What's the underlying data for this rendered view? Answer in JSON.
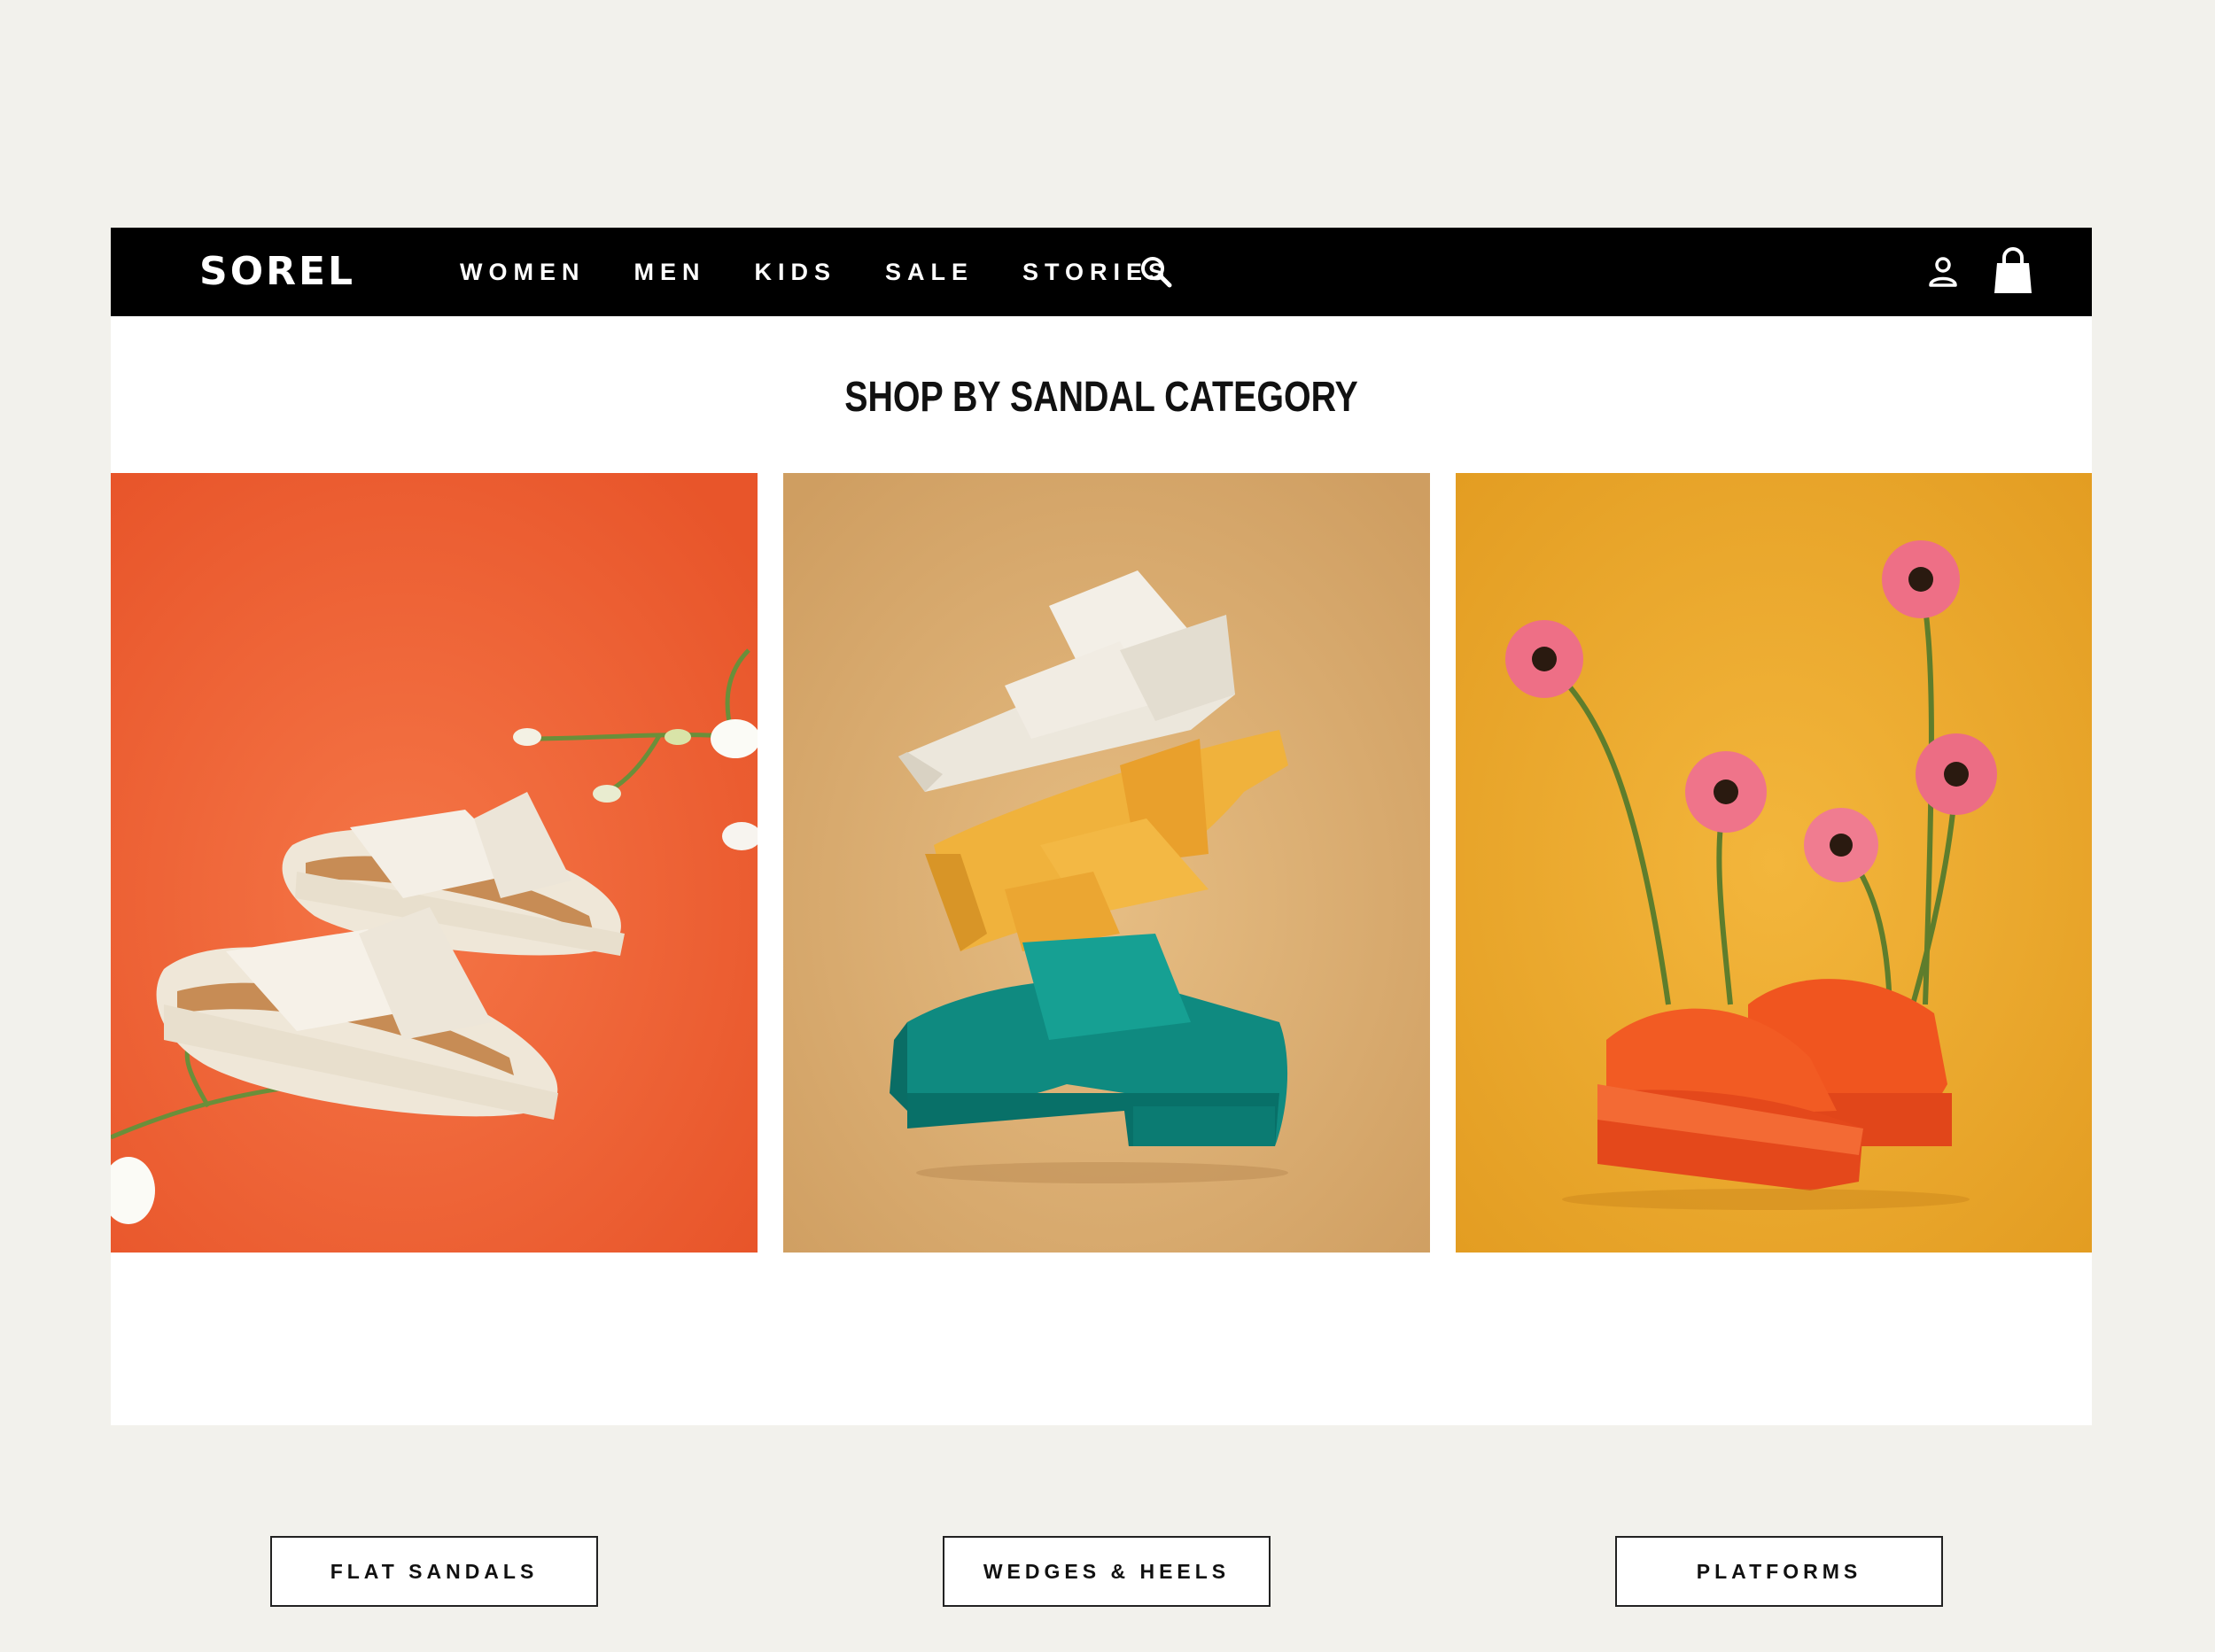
{
  "header": {
    "logo": "SOREL",
    "nav": [
      "WOMEN",
      "MEN",
      "KIDS",
      "SALE",
      "STORIES"
    ],
    "icons": [
      "search-icon",
      "account-icon",
      "shopping-bag-icon"
    ]
  },
  "section": {
    "title": "SHOP BY SANDAL CATEGORY"
  },
  "categories": [
    {
      "label": "FLAT SANDALS",
      "image": "cream-cross-strap-flat-sandals-on-orange",
      "background": "#f26a3b"
    },
    {
      "label": "WEDGES & HEELS",
      "image": "stacked-wedge-heel-sandals-on-tan",
      "background": "#dcae72"
    },
    {
      "label": "PLATFORMS",
      "image": "orange-platform-slides-with-pink-daisies-on-yellow",
      "background": "#eaa82c"
    }
  ],
  "colors": {
    "page_background": "#f2f1ec",
    "header_background": "#000000",
    "header_text": "#ffffff",
    "content_background": "#ffffff"
  }
}
